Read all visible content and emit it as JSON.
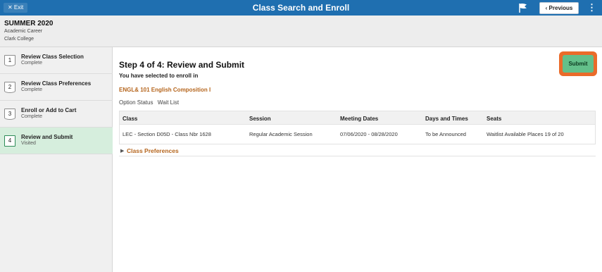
{
  "header": {
    "exit_label": "✕ Exit",
    "title": "Class Search and Enroll",
    "previous_label": "‹ Previous",
    "kebab": "⋮"
  },
  "term": {
    "name": "SUMMER 2020",
    "career": "Academic Career",
    "college": "Clark College"
  },
  "steps": [
    {
      "num": "1",
      "title": "Review Class Selection",
      "status": "Complete"
    },
    {
      "num": "2",
      "title": "Review Class Preferences",
      "status": "Complete"
    },
    {
      "num": "3",
      "title": "Enroll or Add to Cart",
      "status": "Complete"
    },
    {
      "num": "4",
      "title": "Review and Submit",
      "status": "Visited"
    }
  ],
  "main": {
    "heading": "Step 4 of 4: Review and Submit",
    "subheading": "You have selected to enroll in",
    "course": "ENGL& 101   English Composition I",
    "option_label": "Option Status",
    "option_value": "Wait List",
    "submit_label": "Submit",
    "table": {
      "headers": [
        "Class",
        "Session",
        "Meeting Dates",
        "Days and Times",
        "Seats"
      ],
      "rows": [
        [
          "LEC - Section D05D - Class Nbr 1628",
          "Regular Academic Session",
          "07/06/2020 - 08/28/2020",
          "To be Announced",
          "Waitlist Available Places 19 of 20"
        ]
      ]
    },
    "prefs_label": "Class Preferences"
  },
  "colors": {
    "header_bg": "#1f6fb0",
    "submit_bg": "#63c08a",
    "submit_highlight": "#ea6b2a",
    "course_link": "#b5651d",
    "active_step_bg": "#d6eedd"
  },
  "icons": {
    "flag": "flag-icon",
    "kebab": "more-options-icon",
    "prefs_toggle": "triangle-right-icon"
  }
}
